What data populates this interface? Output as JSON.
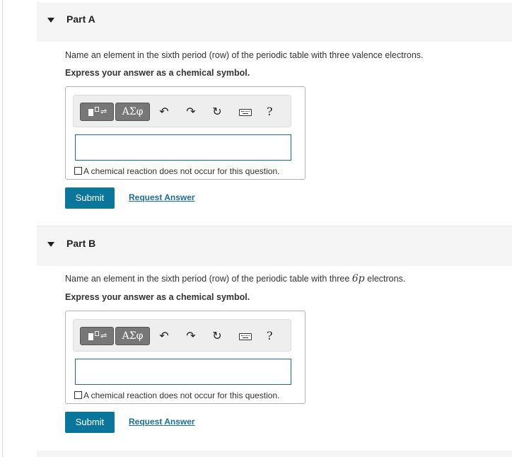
{
  "parts": [
    {
      "title": "Part A",
      "question_before": "Name an element in the sixth period (row) of the periodic table with three valence electrons.",
      "question_math": "",
      "question_after": "",
      "instruction": "Express your answer as a chemical symbol.",
      "answer_value": "",
      "no_reaction_label": "A chemical reaction does not occur for this question.",
      "submit_label": "Submit",
      "request_label": "Request Answer"
    },
    {
      "title": "Part B",
      "question_before": "Name an element in the sixth period (row) of the periodic table with three ",
      "question_math": "6p",
      "question_after": " electrons.",
      "instruction": "Express your answer as a chemical symbol.",
      "answer_value": "",
      "no_reaction_label": "A chemical reaction does not occur for this question.",
      "submit_label": "Submit",
      "request_label": "Request Answer"
    }
  ],
  "toolbar": {
    "greek_label": "ΑΣφ",
    "help_label": "?",
    "icons": [
      "templates-icon",
      "greek-symbols-icon",
      "undo-icon",
      "redo-icon",
      "reset-icon",
      "keyboard-icon",
      "help-icon"
    ]
  },
  "colors": {
    "accent": "#0a769c",
    "link": "#1a6fa0",
    "header_bg": "#f5f5f5"
  }
}
